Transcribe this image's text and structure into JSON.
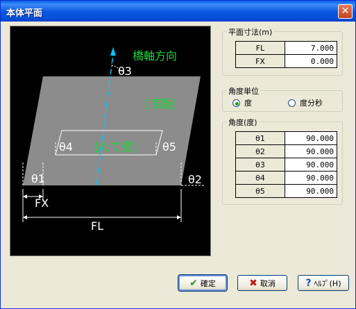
{
  "window": {
    "title": "本体平面",
    "close_glyph": "✕"
  },
  "diagram": {
    "bridge_axis_label": "橋軸方向",
    "slab_label": "[底版]",
    "wall_label": "[たて壁]",
    "theta1": "θ1",
    "theta2": "θ2",
    "theta3": "θ3",
    "theta4": "θ4",
    "theta5": "θ5",
    "fx_label": "FX",
    "fl_label": "FL",
    "colors": {
      "slab": "#8c8c8c",
      "text": "#22d43a",
      "axis": "#00c8ff",
      "background": "#000000"
    }
  },
  "plan_dims": {
    "title": "平面寸法(m)",
    "rows": [
      {
        "label": "FL",
        "value": "7.000"
      },
      {
        "label": "FX",
        "value": "0.000"
      }
    ]
  },
  "angle_unit": {
    "title": "角度単位",
    "options": [
      {
        "label": "度",
        "selected": true
      },
      {
        "label": "度分秒",
        "selected": false
      }
    ]
  },
  "angles": {
    "title": "角度(度)",
    "rows": [
      {
        "label": "θ1",
        "value": "90.000"
      },
      {
        "label": "θ2",
        "value": "90.000"
      },
      {
        "label": "θ3",
        "value": "90.000"
      },
      {
        "label": "θ4",
        "value": "90.000"
      },
      {
        "label": "θ5",
        "value": "90.000"
      }
    ]
  },
  "buttons": {
    "ok": {
      "label": "確定",
      "icon": "check-icon",
      "glyph": "✔",
      "color": "#2f8f2f"
    },
    "cancel": {
      "label": "取消",
      "icon": "x-icon",
      "glyph": "✖",
      "color": "#c01818"
    },
    "help": {
      "label": "ﾍﾙﾌﾟ(H)",
      "icon": "help-icon",
      "glyph": "?",
      "color": "#1c4fb8"
    }
  }
}
